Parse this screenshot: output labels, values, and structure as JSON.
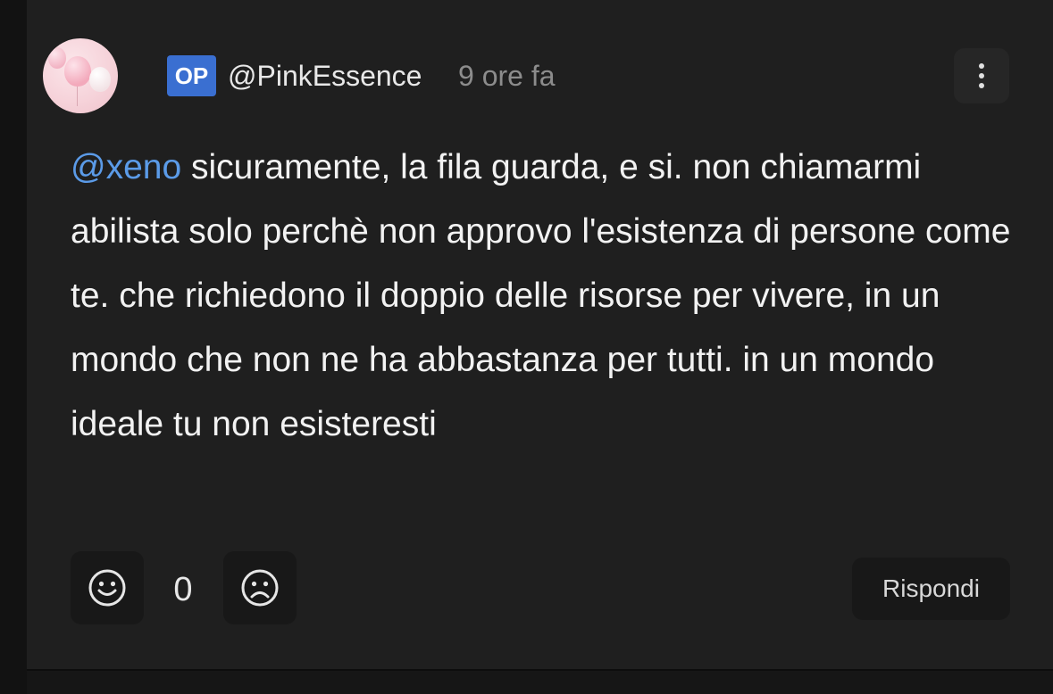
{
  "comment": {
    "op_badge": "OP",
    "username": "@PinkEssence",
    "timestamp": "9 ore fa",
    "avatar_icon": "pink-balloons-avatar",
    "more_icon": "more-vertical-icon",
    "mention": "@xeno",
    "body_text": "sicuramente, la fila guarda, e si. non chiamarmi abilista solo perchè non approvo l'esistenza di persone come te. che richiedono il doppio delle risorse per vivere, in un mondo che non ne ha abbastanza per tutti. in un mondo ideale tu non esisteresti"
  },
  "actions": {
    "like_icon": "smile-icon",
    "dislike_icon": "frown-icon",
    "score": "0",
    "reply_label": "Rispondi"
  },
  "colors": {
    "background": "#1f1f1f",
    "mention": "#5b9be8",
    "op_badge": "#3a6fd1",
    "text": "#f2f2f2",
    "muted": "#8c8c8c"
  }
}
